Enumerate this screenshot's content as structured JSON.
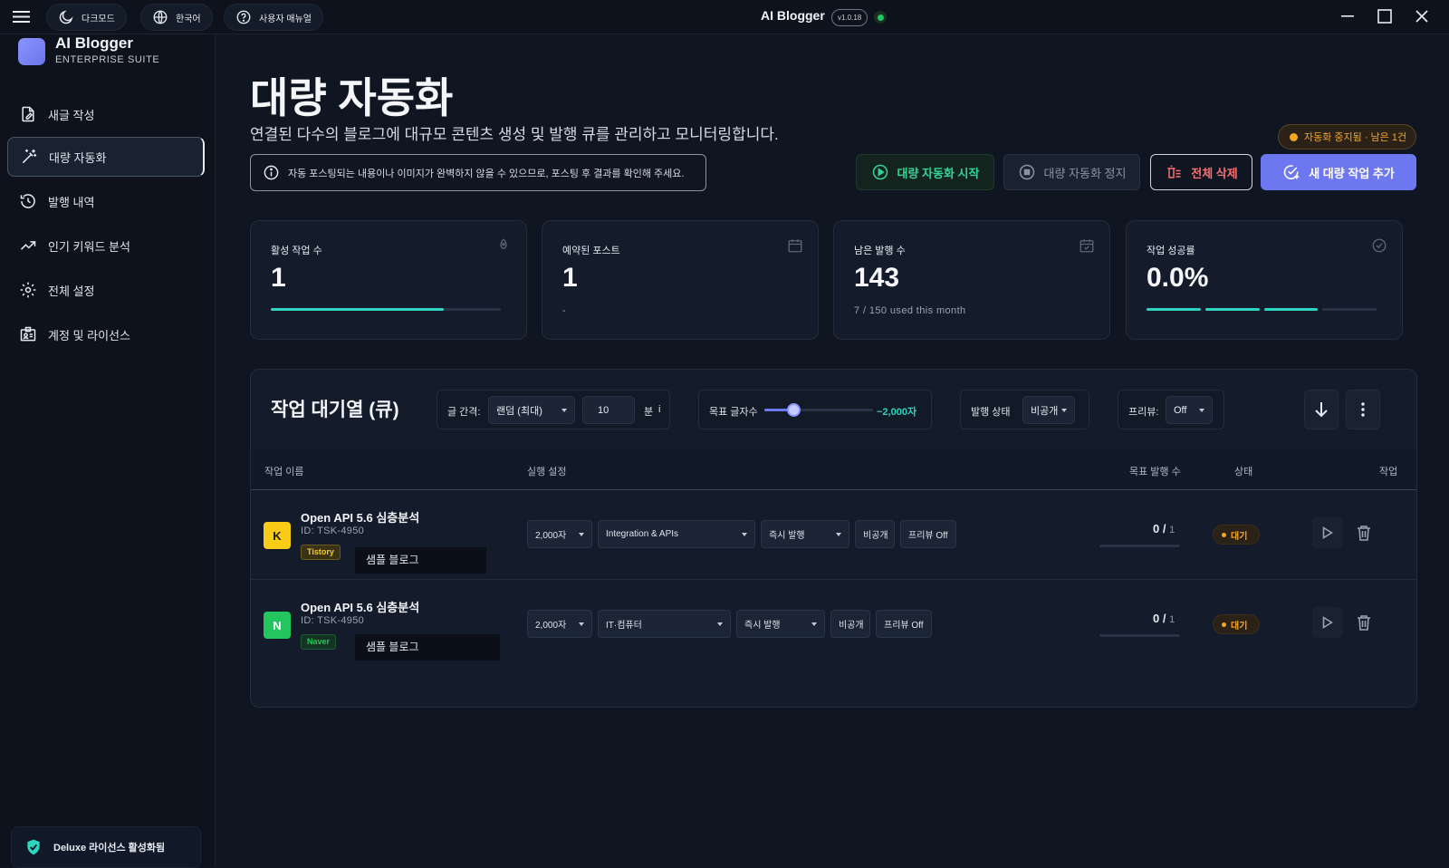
{
  "topbar": {
    "dark_mode": "다크모드",
    "language": "한국어",
    "manual": "사용자 매뉴얼",
    "app_title": "AI Blogger",
    "version": "v1.0.18"
  },
  "sidebar": {
    "brand": "AI Blogger",
    "brand_sub": "ENTERPRISE SUITE",
    "items": [
      {
        "label": "새글 작성",
        "icon": "new-post-icon"
      },
      {
        "label": "대량 자동화",
        "icon": "magic-wand-icon",
        "active": true
      },
      {
        "label": "발행 내역",
        "icon": "history-icon"
      },
      {
        "label": "인기 키워드 분석",
        "icon": "trending-icon"
      },
      {
        "label": "전체 설정",
        "icon": "gear-icon"
      },
      {
        "label": "계정 및 라이선스",
        "icon": "id-card-icon"
      }
    ],
    "license": "Deluxe 라이선스 활성화됨"
  },
  "page": {
    "title": "대량 자동화",
    "description": "연결된 다수의 블로그에 대규모 콘텐츠 생성 및 발행 큐를 관리하고 모니터링합니다.",
    "notice": "자동 포스팅되는 내용이나 이미지가 완벽하지 않을 수 있으므로, 포스팅 후 결과를 확인해 주세요.",
    "status": "자동화 중지됨 · 남은 1건"
  },
  "actions": {
    "start": "대량 자동화 시작",
    "stop": "대량 자동화 정지",
    "delete_all": "전체 삭제",
    "add_new": "새 대량 작업 추가"
  },
  "stats": [
    {
      "label": "활성 작업 수",
      "value": "1",
      "sub": "",
      "progress": 0.75
    },
    {
      "label": "예약된 포스트",
      "value": "1",
      "sub": "-"
    },
    {
      "label": "남은 발행 수",
      "value": "143",
      "sub": "7 / 150 used this month"
    },
    {
      "label": "작업 성공률",
      "value": "0.0%",
      "sub": "",
      "segments_filled": 3,
      "segments_total": 4
    }
  ],
  "queue": {
    "title": "작업 대기열 (큐)",
    "interval_label": "글 간격:",
    "interval_mode": "랜덤 (최대)",
    "interval_value": "10",
    "interval_unit": "분",
    "interval_info": "i",
    "target_chars_label": "목표 글자수",
    "target_chars_value": "~2,000자",
    "target_chars_level": 0.27,
    "publish_status_label": "발행 상태",
    "publish_status_value": "비공개",
    "preview_label": "프리뷰:",
    "preview_value": "Off",
    "columns": [
      "작업 이름",
      "실행 설정",
      "목표 발행 수",
      "상태",
      "작업"
    ],
    "rows": [
      {
        "avatar": "K",
        "name": "Open API 5.6 심층분석",
        "id": "ID: TSK-4950",
        "platform": "Tistory",
        "blog": "샘플 블로그",
        "length": "2,000자",
        "category": "Integration & APIs",
        "timing": "즉시 발행",
        "visibility": "비공개",
        "preview": "프리뷰 Off",
        "done": "0",
        "sep": " / ",
        "target": "1",
        "status": "대기"
      },
      {
        "avatar": "N",
        "name": "Open API 5.6 심층분석",
        "id": "ID: TSK-4950",
        "platform": "Naver",
        "blog": "샘플 블로그",
        "length": "2,000자",
        "category": "IT·컴퓨터",
        "timing": "즉시 발행",
        "visibility": "비공개",
        "preview": "프리뷰 Off",
        "done": "0",
        "sep": " / ",
        "target": "1",
        "status": "대기"
      }
    ]
  },
  "colors": {
    "accent": "#6d78f0",
    "teal": "#2dd4bf",
    "green": "#22c55e",
    "warning": "#f5a623",
    "danger": "#f87171",
    "tistory": "#facc15",
    "naver": "#22c55e"
  }
}
